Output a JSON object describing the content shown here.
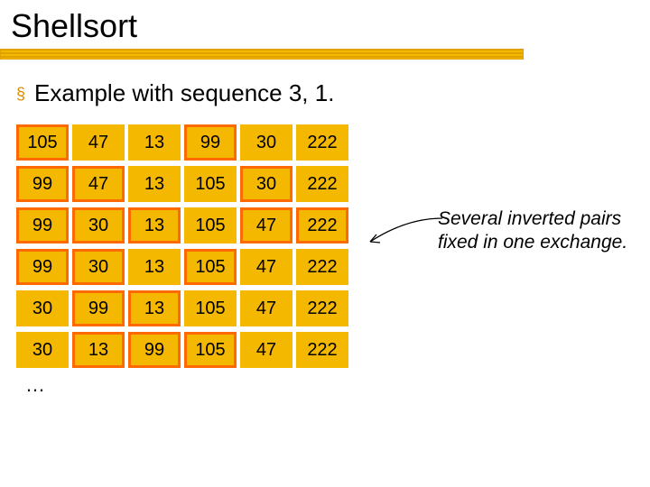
{
  "title": "Shellsort",
  "subtitle": "Example with sequence 3, 1.",
  "rows": [
    {
      "cells": [
        {
          "v": "105",
          "hl": true
        },
        {
          "v": "47",
          "hl": false
        },
        {
          "v": "13",
          "hl": false
        },
        {
          "v": "99",
          "hl": true
        },
        {
          "v": "30",
          "hl": false
        },
        {
          "v": "222",
          "hl": false
        }
      ]
    },
    {
      "cells": [
        {
          "v": "99",
          "hl": true
        },
        {
          "v": "47",
          "hl": true
        },
        {
          "v": "13",
          "hl": false
        },
        {
          "v": "105",
          "hl": false
        },
        {
          "v": "30",
          "hl": true
        },
        {
          "v": "222",
          "hl": false
        }
      ]
    },
    {
      "cells": [
        {
          "v": "99",
          "hl": true
        },
        {
          "v": "30",
          "hl": true
        },
        {
          "v": "13",
          "hl": true
        },
        {
          "v": "105",
          "hl": false
        },
        {
          "v": "47",
          "hl": true
        },
        {
          "v": "222",
          "hl": true
        }
      ]
    },
    {
      "cells": [
        {
          "v": "99",
          "hl": true
        },
        {
          "v": "30",
          "hl": true
        },
        {
          "v": "13",
          "hl": false
        },
        {
          "v": "105",
          "hl": true
        },
        {
          "v": "47",
          "hl": false
        },
        {
          "v": "222",
          "hl": false
        }
      ]
    },
    {
      "cells": [
        {
          "v": "30",
          "hl": false
        },
        {
          "v": "99",
          "hl": true
        },
        {
          "v": "13",
          "hl": true
        },
        {
          "v": "105",
          "hl": false
        },
        {
          "v": "47",
          "hl": false
        },
        {
          "v": "222",
          "hl": false
        }
      ]
    },
    {
      "cells": [
        {
          "v": "30",
          "hl": false
        },
        {
          "v": "13",
          "hl": true
        },
        {
          "v": "99",
          "hl": true
        },
        {
          "v": "105",
          "hl": true
        },
        {
          "v": "47",
          "hl": false
        },
        {
          "v": "222",
          "hl": false
        }
      ]
    }
  ],
  "ellipsis": "…",
  "annotation": "Several inverted pairs fixed in one exchange.",
  "colors": {
    "cell_fill": "#f5b800",
    "highlight_border": "#ff6a00",
    "bullet": "#e08a00"
  }
}
